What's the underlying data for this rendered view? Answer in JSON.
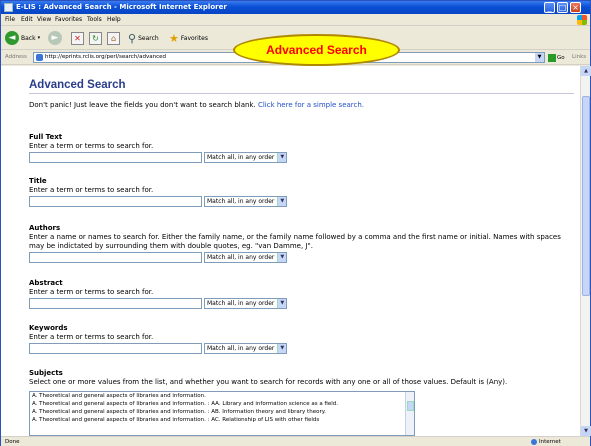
{
  "window": {
    "title": "E-LIS : Advanced Search - Microsoft Internet Explorer",
    "controls": {
      "minimize": "_",
      "maximize": "□",
      "close": "×"
    }
  },
  "menubar": {
    "items": [
      "File",
      "Edit",
      "View",
      "Favorites",
      "Tools",
      "Help"
    ]
  },
  "toolbar": {
    "back": "Back",
    "search": "Search",
    "favorites": "Favorites"
  },
  "address": {
    "label": "Address",
    "url": "http://eprints.rclis.org/perl/search/advanced",
    "go": "Go",
    "links": "Links"
  },
  "callout": {
    "text": "Advanced Search"
  },
  "page": {
    "title": "Advanced Search",
    "intro_text": "Don't panic! Just leave the fields you don't want to search blank.",
    "intro_link": "Click here for a simple search.",
    "sections": [
      {
        "label": "Full Text",
        "help": "Enter a term or terms to search for.",
        "match": "Match all, in any order"
      },
      {
        "label": "Title",
        "help": "Enter a term or terms to search for.",
        "match": "Match all, in any order"
      },
      {
        "label": "Authors",
        "help": "Enter a name or names to search for. Either the family name, or the family name followed by a comma and the first name or initial. Names with spaces may be indictated by surrounding them with double quotes, eg. \"van Damme, J\".",
        "match": "Match all, in any order"
      },
      {
        "label": "Abstract",
        "help": "Enter a term or terms to search for.",
        "match": "Match all, in any order"
      },
      {
        "label": "Keywords",
        "help": "Enter a term or terms to search for.",
        "match": "Match all, in any order"
      }
    ],
    "subjects": {
      "label": "Subjects",
      "help": "Select one or more values from the list, and whether you want to search for records with any one or all of those values. Default is (Any).",
      "options": [
        "A. Theoretical and general aspects of libraries and information.",
        "A. Theoretical and general aspects of libraries and information. : AA. Library and information science as a field.",
        "A. Theoretical and general aspects of libraries and information. : AB. Information theory and library theory.",
        "A. Theoretical and general aspects of libraries and information. : AC. Relationship of LIS with other fields"
      ]
    }
  },
  "status": {
    "left": "Done",
    "right": "Internet"
  }
}
